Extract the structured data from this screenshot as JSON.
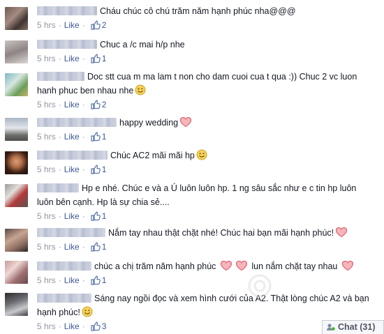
{
  "comments": [
    {
      "name_width": 84,
      "text": "Cháu chúc cô chú trăm năm hạnh phúc nha@@@",
      "time": "5 hrs",
      "like_label": "Like",
      "likes": "2",
      "avatar": "avatar-1",
      "icons": []
    },
    {
      "name_width": 84,
      "text": "Chuc a /c mai h/p nhe",
      "time": "5 hrs",
      "like_label": "Like",
      "likes": "1",
      "avatar": "avatar-2",
      "icons": []
    },
    {
      "name_width": 66,
      "text": "Doc stt cua m ma lam t non cho dam cuoi cua t qua :)) Chuc 2 vc luon",
      "text2": "hanh phuc ben nhau nhe",
      "time": "5 hrs",
      "like_label": "Like",
      "likes": "2",
      "avatar": "avatar-3",
      "icons": [
        "smiley-icon"
      ]
    },
    {
      "name_width": 112,
      "text": "happy wedding",
      "time": "5 hrs",
      "like_label": "Like",
      "likes": "1",
      "avatar": "avatar-4",
      "icons": [
        "heart-icon"
      ]
    },
    {
      "name_width": 99,
      "text": "Chúc AC2 mãi mãi hp",
      "time": "5 hrs",
      "like_label": "Like",
      "likes": "1",
      "avatar": "avatar-5",
      "icons": [
        "smiley-icon"
      ]
    },
    {
      "name_width": 58,
      "text": "Hp e nhé. Chúc e và a Ú luôn luôn hp. 1 ng sâu sắc như e c tin hp luôn",
      "text2": "luôn bên cạnh. Hp là sự chia sẻ....",
      "time": "5 hrs",
      "like_label": "Like",
      "likes": "1",
      "avatar": "avatar-6",
      "icons": []
    },
    {
      "name_width": 96,
      "text": "Nắm tay nhau thật chặt nhé! Chúc hai bạn mãi hạnh phúc!",
      "time": "5 hrs",
      "like_label": "Like",
      "likes": "1",
      "avatar": "avatar-7",
      "icons": [
        "heart-icon"
      ]
    },
    {
      "name_width": 76,
      "text": "chúc a chị trăm năm hạnh phúc",
      "text_mid": "lun nắm chặt tay nhau",
      "time": "5 hrs",
      "like_label": "Like",
      "likes": "1",
      "avatar": "avatar-8",
      "icons": [
        "heart-icon",
        "heart-icon",
        "heart-icon"
      ]
    },
    {
      "name_width": 76,
      "text": "Sáng nay ngồi đọc và xem hình cưới của A2. Thật lòng chúc A2 và bạn",
      "text2": "hạnh phúc!",
      "time": "5 hrs",
      "like_label": "Like",
      "likes": "3",
      "avatar": "avatar-9",
      "icons": [
        "smiley-icon"
      ]
    }
  ],
  "chat": {
    "label": "Chat",
    "count": "(31)"
  },
  "colors": {
    "link": "#3b5998",
    "meta": "#9197a3",
    "text": "#141823",
    "heart": "#e8717b"
  }
}
